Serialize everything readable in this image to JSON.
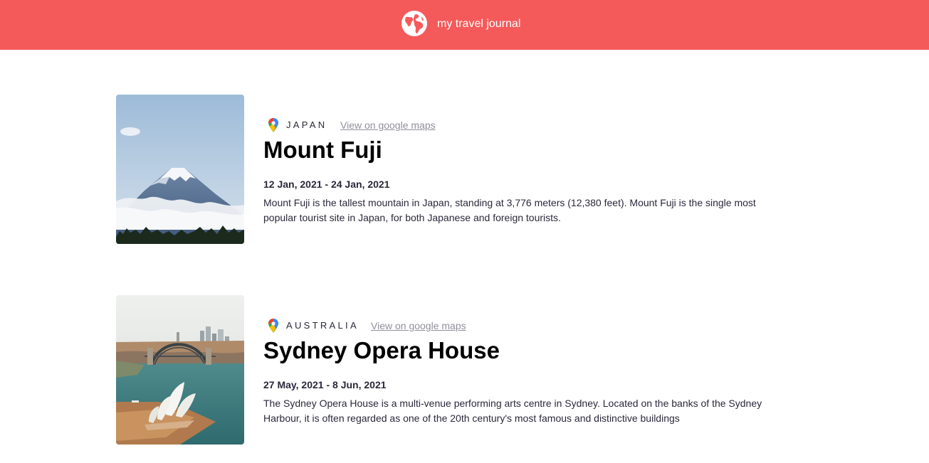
{
  "header": {
    "title": "my travel journal",
    "icon": "globe-icon",
    "background": "#F55A5A"
  },
  "entries": [
    {
      "country": "JAPAN",
      "maps_link": "View on google maps",
      "title": "Mount Fuji",
      "dates": "12 Jan, 2021 - 24 Jan, 2021",
      "description": "Mount Fuji is the tallest mountain in Japan, standing at 3,776 meters (12,380 feet). Mount Fuji is the single most popular tourist site in Japan, for both Japanese and foreign tourists.",
      "image": "mount-fuji-photo"
    },
    {
      "country": "AUSTRALIA",
      "maps_link": "View on google maps",
      "title": "Sydney Opera House",
      "dates": "27 May, 2021 - 8 Jun, 2021",
      "description": "The Sydney Opera House is a multi-venue performing arts centre in Sydney. Located on the banks of the Sydney Harbour, it is often regarded as one of the 20th century's most famous and distinctive buildings",
      "image": "sydney-opera-house-photo"
    }
  ],
  "colors": {
    "accent": "#F55A5A",
    "text": "#2B283A",
    "link": "#918E9B"
  }
}
